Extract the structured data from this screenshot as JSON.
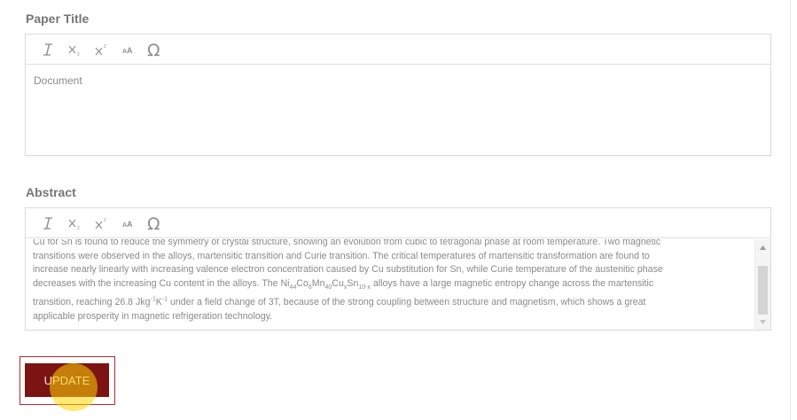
{
  "paper_title": {
    "label": "Paper Title",
    "toolbar": [
      "italic-icon",
      "subscript-icon",
      "superscript-icon",
      "font-size-icon",
      "omega-icon"
    ],
    "content": "Document"
  },
  "abstract": {
    "label": "Abstract",
    "toolbar": [
      "italic-icon",
      "subscript-icon",
      "superscript-icon",
      "font-size-icon",
      "omega-icon"
    ],
    "line1": "Cu for Sn is found to reduce the symmetry of crystal structure, showing an evolution from cubic to tetragonal phase at room temperature. Two magnetic",
    "line2": "transitions were observed in the alloys, martensitic transition and Curie transition. The critical temperatures of martensitic transformation are found to",
    "line3": "increase nearly linearly with increasing valence electron concentration caused by Cu substitution for Sn, while Curie temperature of the austenitic phase",
    "line4": "decreases with the increasing Cu content in the alloys. The",
    "formula": {
      "ni": "Ni",
      "ni_sub": "44",
      "co": "Co",
      "co_sub": "6",
      "mn": "Mn",
      "mn_sub": "40",
      "cu": "Cu",
      "cu_sub": "x",
      "sn": "Sn",
      "sn_sub": "10-x"
    },
    "line4_end": "alloys have a large magnetic entropy change across the martensitic",
    "line5_start": "transition, reaching 26.8 Jkg",
    "line5_sup1": "-1",
    "line5_mid": "K",
    "line5_sup2": "-1",
    "line5_end": "under a field change of 3T, because of the strong coupling between structure and magnetism, which shows a great",
    "line6": "applicable prosperity in magnetic refrigeration technology."
  },
  "update_button": {
    "label": "UPDATE"
  },
  "colors": {
    "button": "#7c1414",
    "frame": "#c0262d",
    "cursor": "#ffd600"
  }
}
